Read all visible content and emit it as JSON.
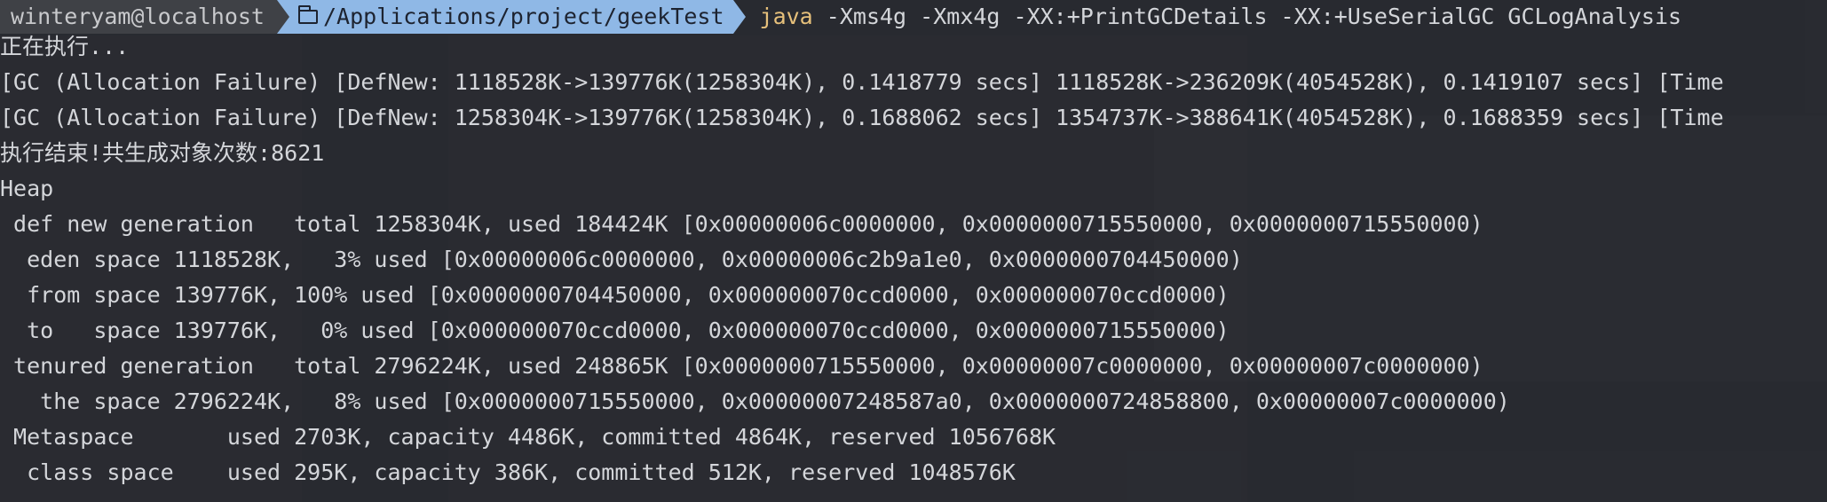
{
  "prompt": {
    "user_host": "winteryam@localhost",
    "directory": "/Applications/project/geekTest",
    "command_program": "java",
    "command_args": " -Xms4g -Xmx4g -XX:+PrintGCDetails -XX:+UseSerialGC  GCLogAnalysis"
  },
  "output_lines": [
    "正在执行...",
    "[GC (Allocation Failure) [DefNew: 1118528K->139776K(1258304K), 0.1418779 secs] 1118528K->236209K(4054528K), 0.1419107 secs] [Time",
    "[GC (Allocation Failure) [DefNew: 1258304K->139776K(1258304K), 0.1688062 secs] 1354737K->388641K(4054528K), 0.1688359 secs] [Time",
    "执行结束!共生成对象次数:8621",
    "Heap",
    " def new generation   total 1258304K, used 184424K [0x00000006c0000000, 0x0000000715550000, 0x0000000715550000)",
    "  eden space 1118528K,   3% used [0x00000006c0000000, 0x00000006c2b9a1e0, 0x0000000704450000)",
    "  from space 139776K, 100% used [0x0000000704450000, 0x000000070ccd0000, 0x000000070ccd0000)",
    "  to   space 139776K,   0% used [0x000000070ccd0000, 0x000000070ccd0000, 0x0000000715550000)",
    " tenured generation   total 2796224K, used 248865K [0x0000000715550000, 0x00000007c0000000, 0x00000007c0000000)",
    "   the space 2796224K,   8% used [0x0000000715550000, 0x00000007248587a0, 0x0000000724858800, 0x00000007c0000000)",
    " Metaspace       used 2703K, capacity 4486K, committed 4864K, reserved 1056768K",
    "  class space    used 295K, capacity 386K, committed 512K, reserved 1048576K"
  ],
  "colors": {
    "background": "#2b2d33",
    "text": "#d4d6da",
    "prompt_user_bg": "#3f4146",
    "prompt_dir_bg": "#8fb8e6",
    "command_keyword": "#e6c07b"
  },
  "icons": {
    "directory": "folder-icon"
  }
}
